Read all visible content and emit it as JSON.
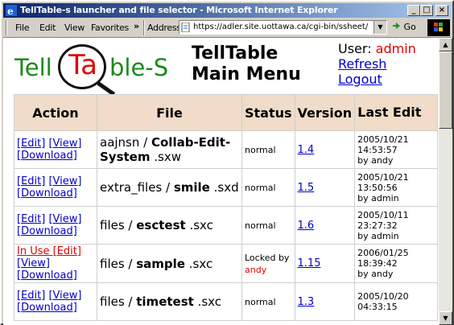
{
  "window": {
    "title": "TellTable-s launcher and file selector - Microsoft Internet Explorer",
    "controls": [
      "_",
      "□",
      "×"
    ]
  },
  "toolbar": {
    "menus": [
      "File",
      "Edit",
      "View",
      "Favorites"
    ],
    "overflow": "»",
    "address_label": "Address",
    "url": "https://adler.site.uottawa.ca/cgi-bin/ssheet/ssheetg",
    "go_label": "Go"
  },
  "header": {
    "logo": {
      "part1": "Tell",
      "part2": "Ta",
      "part3": "ble-S"
    },
    "title_line1": "TellTable",
    "title_line2": "Main Menu",
    "user_label": "User:",
    "user_name": "admin",
    "refresh_link": "Refresh",
    "logout_link": "Logout"
  },
  "table": {
    "columns": [
      "Action",
      "File",
      "Status",
      "Version",
      "Last Edit"
    ],
    "rows": [
      {
        "in_use": "",
        "edit": "[Edit]",
        "view": "[View]",
        "download": "[Download]",
        "file_prefix": "aajnsn / ",
        "file_name": "Collab-Edit-System",
        "file_ext": " .sxw",
        "status": "normal",
        "locked_by": "",
        "version": "1.4",
        "edit_date": "2005/10/21",
        "edit_time": "14:53:57",
        "edit_by": "by andy"
      },
      {
        "in_use": "",
        "edit": "[Edit]",
        "view": "[View]",
        "download": "[Download]",
        "file_prefix": "extra_files / ",
        "file_name": "smile",
        "file_ext": " .sxd",
        "status": "normal",
        "locked_by": "",
        "version": "1.5",
        "edit_date": "2005/10/21",
        "edit_time": "13:50:56",
        "edit_by": "by admin"
      },
      {
        "in_use": "",
        "edit": "[Edit]",
        "view": "[View]",
        "download": "[Download]",
        "file_prefix": "files / ",
        "file_name": "esctest",
        "file_ext": " .sxc",
        "status": "normal",
        "locked_by": "",
        "version": "1.6",
        "edit_date": "2005/10/11",
        "edit_time": "23:27:32",
        "edit_by": "by admin"
      },
      {
        "in_use": "In Use [Edit]",
        "edit": "",
        "view": "[View]",
        "download": "[Download]",
        "file_prefix": "files / ",
        "file_name": "sample",
        "file_ext": " .sxc",
        "status": "Locked by",
        "locked_by": "andy",
        "version": "1.15",
        "edit_date": "2006/01/25",
        "edit_time": "18:39:42",
        "edit_by": "by andy"
      },
      {
        "in_use": "",
        "edit": "[Edit]",
        "view": "[View]",
        "download": "[Download]",
        "file_prefix": "files / ",
        "file_name": "timetest",
        "file_ext": " .sxc",
        "status": "normal",
        "locked_by": "",
        "version": "1.3",
        "edit_date": "2005/10/20",
        "edit_time": "04:33:15",
        "edit_by": ""
      }
    ]
  }
}
